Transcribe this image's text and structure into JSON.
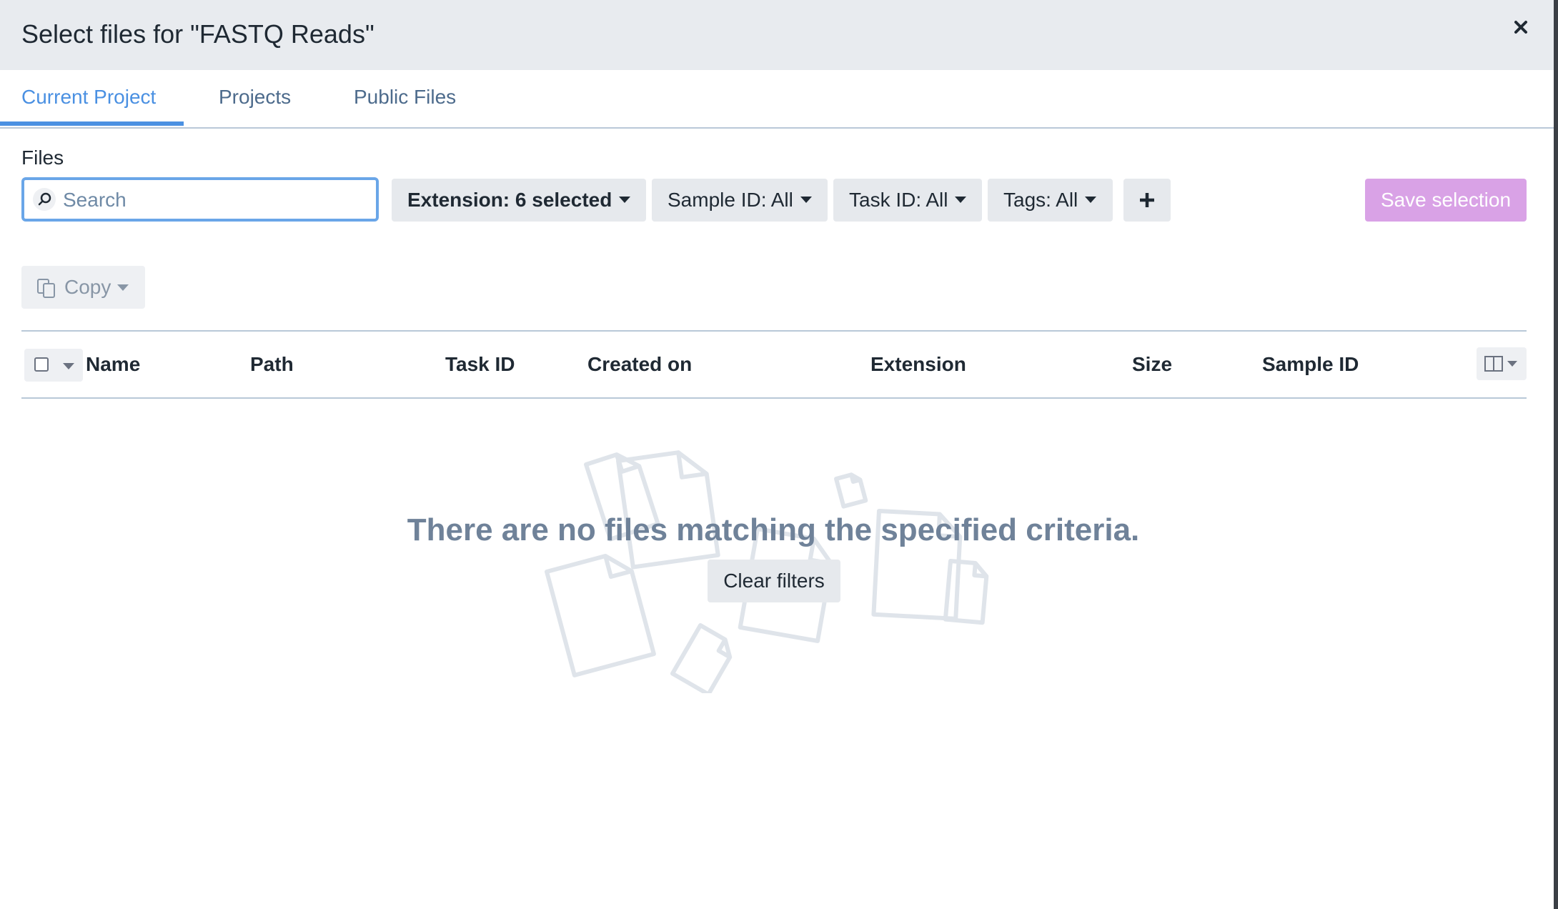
{
  "modal": {
    "title": "Select files for \"FASTQ Reads\"",
    "close_icon": "close-icon"
  },
  "tabs": [
    {
      "label": "Current Project",
      "active": true
    },
    {
      "label": "Projects",
      "active": false
    },
    {
      "label": "Public Files",
      "active": false
    }
  ],
  "files": {
    "section_label": "Files",
    "search": {
      "placeholder": "Search",
      "value": "",
      "icon": "search-icon"
    },
    "filters": [
      {
        "label": "Extension: 6 selected"
      },
      {
        "label": "Sample ID: All"
      },
      {
        "label": "Task ID: All"
      },
      {
        "label": "Tags: All"
      }
    ],
    "add_filter_icon": "plus-icon",
    "save_label": "Save selection",
    "copy_label": "Copy"
  },
  "table": {
    "columns": [
      "Name",
      "Path",
      "Task ID",
      "Created on",
      "Extension",
      "Size",
      "Sample ID"
    ],
    "column_toggle_icon": "columns-icon"
  },
  "empty_state": {
    "message": "There are no files matching the specified criteria.",
    "clear_label": "Clear filters"
  },
  "colors": {
    "accent": "#4a90e2",
    "save_button": "#d9a2e6",
    "header_bg": "#e8ebef",
    "empty_text": "#6f8299"
  }
}
